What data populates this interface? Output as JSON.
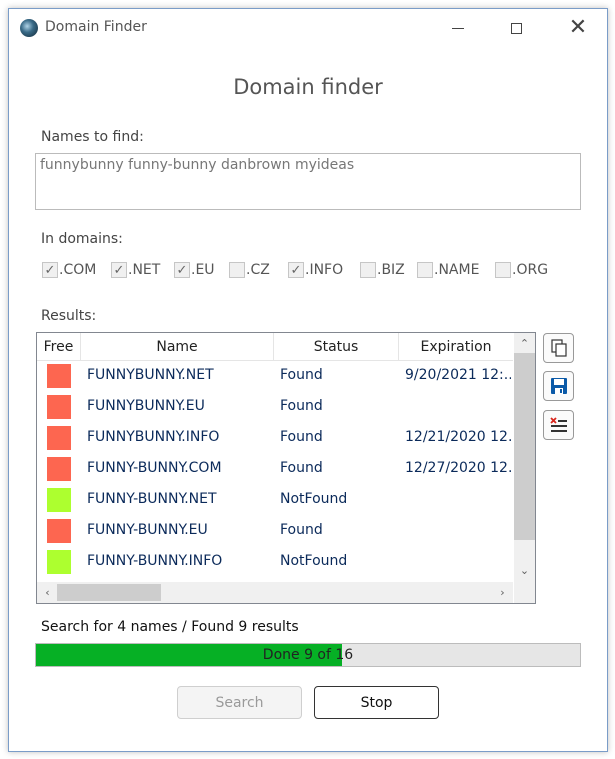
{
  "window": {
    "title": "Domain Finder"
  },
  "heading": "Domain finder",
  "names": {
    "label": "Names to find:",
    "value": "funnybunny funny-bunny danbrown myideas"
  },
  "domains": {
    "label": "In domains:",
    "items": [
      {
        "label": ".COM",
        "checked": true
      },
      {
        "label": ".NET",
        "checked": true
      },
      {
        "label": ".EU",
        "checked": true
      },
      {
        "label": ".CZ",
        "checked": false
      },
      {
        "label": ".INFO",
        "checked": true
      },
      {
        "label": ".BIZ",
        "checked": false
      },
      {
        "label": ".NAME",
        "checked": false
      },
      {
        "label": ".ORG",
        "checked": false
      }
    ]
  },
  "results": {
    "label": "Results:",
    "columns": [
      "Free",
      "Name",
      "Status",
      "Expiration"
    ],
    "rows": [
      {
        "free": false,
        "name": "FUNNYBUNNY.NET",
        "status": "Found",
        "expiration": "9/20/2021 12:..."
      },
      {
        "free": false,
        "name": "FUNNYBUNNY.EU",
        "status": "Found",
        "expiration": ""
      },
      {
        "free": false,
        "name": "FUNNYBUNNY.INFO",
        "status": "Found",
        "expiration": "12/21/2020 12..."
      },
      {
        "free": false,
        "name": "FUNNY-BUNNY.COM",
        "status": "Found",
        "expiration": "12/27/2020 12..."
      },
      {
        "free": true,
        "name": "FUNNY-BUNNY.NET",
        "status": "NotFound",
        "expiration": ""
      },
      {
        "free": false,
        "name": "FUNNY-BUNNY.EU",
        "status": "Found",
        "expiration": ""
      },
      {
        "free": true,
        "name": "FUNNY-BUNNY.INFO",
        "status": "NotFound",
        "expiration": ""
      }
    ]
  },
  "colors": {
    "taken": "#fd6650",
    "free": "#adff2f",
    "progress": "#06b025",
    "accent": "#0b5aa8"
  },
  "side_buttons": [
    {
      "icon": "copy-icon"
    },
    {
      "icon": "save-icon"
    },
    {
      "icon": "clear-list-icon"
    }
  ],
  "status_text": "Search for 4 names /  Found 9 results",
  "progress": {
    "text": "Done 9 of 16",
    "fraction": 0.5625
  },
  "buttons": {
    "search": "Search",
    "stop": "Stop"
  }
}
